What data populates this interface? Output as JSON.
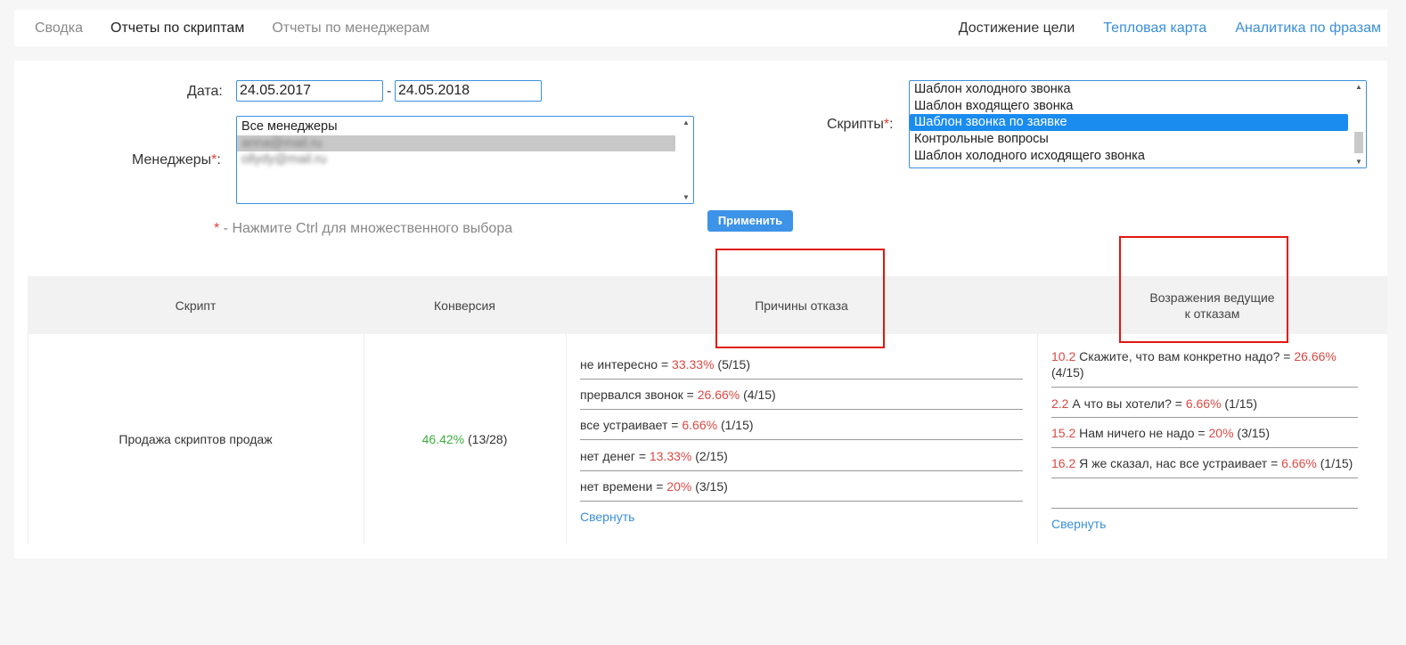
{
  "nav": {
    "left": [
      "Сводка",
      "Отчеты по скриптам",
      "Отчеты по менеджерам"
    ],
    "right": [
      "Достижение цели",
      "Тепловая карта",
      "Аналитика по фразам"
    ]
  },
  "filters": {
    "date_label": "Дата:",
    "date_from": "24.05.2017",
    "date_sep": "-",
    "date_to": "24.05.2018",
    "managers_label": "Менеджеры",
    "managers_options": [
      "Все менеджеры",
      "anna@mail.ru",
      "ollydy@mail.ru"
    ],
    "scripts_label": "Скрипты",
    "scripts_options": [
      "Шаблон холодного звонка",
      "Шаблон входящего звонка",
      "Шаблон звонка по заявке",
      "Контрольные вопросы",
      "Шаблон холодного исходящего звонка"
    ],
    "required_mark": "*",
    "hint_text": " - Нажмите Ctrl для множественного выбора",
    "apply_label": "Применить"
  },
  "table": {
    "headers": [
      "Скрипт",
      "Конверсия",
      "Причины отказа",
      "Возражения ведущие",
      "к отказам"
    ],
    "row": {
      "script": "Продажа скриптов продаж",
      "conversion_pct": "46.42%",
      "conversion_count": "(13/28)",
      "reasons": [
        {
          "text": "не интересно = ",
          "pct": "33.33%",
          "count": " (5/15)"
        },
        {
          "text": "прервался звонок = ",
          "pct": "26.66%",
          "count": " (4/15)"
        },
        {
          "text": "все устраивает = ",
          "pct": "6.66%",
          "count": " (1/15)"
        },
        {
          "text": "нет денег = ",
          "pct": "13.33%",
          "count": " (2/15)"
        },
        {
          "text": "нет времени = ",
          "pct": "20%",
          "count": " (3/15)"
        }
      ],
      "objections": [
        {
          "num": "10.2",
          "text": " Скажите, что вам конкретно надо? = ",
          "pct": "26.66%",
          "count": "(4/15)"
        },
        {
          "num": "2.2",
          "text": " А что вы хотели? = ",
          "pct": "6.66%",
          "count": " (1/15)"
        },
        {
          "num": "15.2",
          "text": " Нам ничего не надо = ",
          "pct": "20%",
          "count": " (3/15)"
        },
        {
          "num": "16.2",
          "text": " Я же сказал, нас все устраивает = ",
          "pct": "6.66%",
          "count": " (1/15)"
        }
      ],
      "collapse": "Свернуть"
    }
  },
  "colors": {
    "accent": "#3d93e8",
    "red": "#d94a44",
    "green": "#3dae3d",
    "highlight": "#e2160f"
  }
}
